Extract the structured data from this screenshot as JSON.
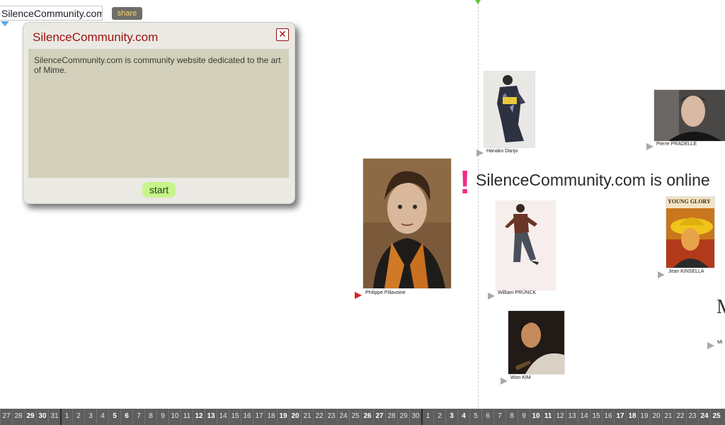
{
  "site_title": "SilenceCommunity.com",
  "share_label": "share",
  "popup": {
    "title": "SilenceCommunity.com",
    "close_symbol": "✕",
    "body": "SilenceCommunity.com is community website dedicated to the art of Mime.",
    "start_label": "start"
  },
  "headline": {
    "mark": "!",
    "text": "SilenceCommunity.com is online"
  },
  "people": [
    {
      "name": "Hanako Danjo",
      "arrow": "play-arrow-grey-icon"
    },
    {
      "name": "Pierre PRADELLE",
      "arrow": "play-arrow-grey-icon"
    },
    {
      "name": "Philippe Pillavoine",
      "arrow": "play-arrow-red-icon"
    },
    {
      "name": "William PRÜNCK",
      "arrow": "play-arrow-grey-icon"
    },
    {
      "name": "Jean KINSELLA",
      "arrow": "play-arrow-grey-icon"
    },
    {
      "name": "Won KIM",
      "arrow": "play-arrow-grey-icon"
    },
    {
      "name": "Mi",
      "arrow": "play-arrow-grey-icon"
    }
  ],
  "poster_text": "YOUNG GLORY",
  "days": [
    {
      "d": "27",
      "we": false
    },
    {
      "d": "28",
      "we": false
    },
    {
      "d": "29",
      "we": true
    },
    {
      "d": "30",
      "we": true
    },
    {
      "d": "31",
      "we": false
    },
    {
      "d": "1",
      "we": false,
      "month": true
    },
    {
      "d": "2",
      "we": false
    },
    {
      "d": "3",
      "we": false
    },
    {
      "d": "4",
      "we": false
    },
    {
      "d": "5",
      "we": true
    },
    {
      "d": "6",
      "we": true
    },
    {
      "d": "7",
      "we": false
    },
    {
      "d": "8",
      "we": false
    },
    {
      "d": "9",
      "we": false
    },
    {
      "d": "10",
      "we": false
    },
    {
      "d": "11",
      "we": false
    },
    {
      "d": "12",
      "we": true
    },
    {
      "d": "13",
      "we": true
    },
    {
      "d": "14",
      "we": false
    },
    {
      "d": "15",
      "we": false
    },
    {
      "d": "16",
      "we": false
    },
    {
      "d": "17",
      "we": false
    },
    {
      "d": "18",
      "we": false
    },
    {
      "d": "19",
      "we": true
    },
    {
      "d": "20",
      "we": true
    },
    {
      "d": "21",
      "we": false
    },
    {
      "d": "22",
      "we": false
    },
    {
      "d": "23",
      "we": false
    },
    {
      "d": "24",
      "we": false
    },
    {
      "d": "25",
      "we": false
    },
    {
      "d": "26",
      "we": true
    },
    {
      "d": "27",
      "we": true
    },
    {
      "d": "28",
      "we": false
    },
    {
      "d": "29",
      "we": false
    },
    {
      "d": "30",
      "we": false
    },
    {
      "d": "1",
      "we": false,
      "month": true
    },
    {
      "d": "2",
      "we": false
    },
    {
      "d": "3",
      "we": true
    },
    {
      "d": "4",
      "we": true
    },
    {
      "d": "5",
      "we": false
    },
    {
      "d": "6",
      "we": false
    },
    {
      "d": "7",
      "we": false
    },
    {
      "d": "8",
      "we": false
    },
    {
      "d": "9",
      "we": false
    },
    {
      "d": "10",
      "we": true
    },
    {
      "d": "11",
      "we": true
    },
    {
      "d": "12",
      "we": false
    },
    {
      "d": "13",
      "we": false
    },
    {
      "d": "14",
      "we": false
    },
    {
      "d": "15",
      "we": false
    },
    {
      "d": "16",
      "we": false
    },
    {
      "d": "17",
      "we": true
    },
    {
      "d": "18",
      "we": true
    },
    {
      "d": "19",
      "we": false
    },
    {
      "d": "20",
      "we": false
    },
    {
      "d": "21",
      "we": false
    },
    {
      "d": "22",
      "we": false
    },
    {
      "d": "23",
      "we": false
    },
    {
      "d": "24",
      "we": true
    },
    {
      "d": "25",
      "we": true
    }
  ]
}
